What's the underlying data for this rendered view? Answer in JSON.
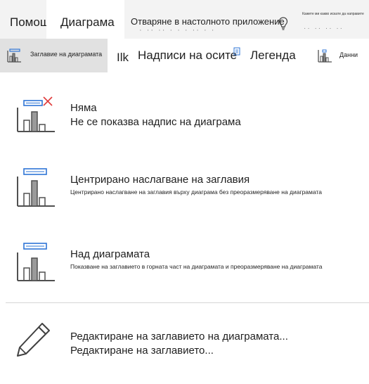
{
  "tabs": {
    "help": "Помощ",
    "chart": "Диаграма",
    "open_desktop": "Отваряне в настолното приложение",
    "open_desktop_faded": "· ·· ·· ·  · · ··  · ·",
    "tell_me": "Кажете ми какво искате да направите",
    "tell_me_faded": "·· ·· ·· ··"
  },
  "ribbon": {
    "chart_title": "Заглавие на диаграмата",
    "axis_ilk": "Ilk",
    "axis_titles": "Надписи на осите",
    "legend": "Легенда",
    "data": "Данни"
  },
  "menu": {
    "items": [
      {
        "title": "Няма",
        "subtitle": "Не се показва надпис на диаграма",
        "icon": "chart-no-title-icon"
      },
      {
        "title": "Центрирано наслагване на заглавия",
        "subtitle": "Центрирано наслагване на заглавия върху диаграма без преоразмеряване на диаграмата",
        "icon": "chart-centered-overlay-title-icon"
      },
      {
        "title": "Над диаграмата",
        "subtitle": "Показване на заглавието в горната част на диаграмата и преоразмеряване на диаграмата",
        "icon": "chart-title-above-icon"
      },
      {
        "title": "Редактиране на заглавието на диаграмата...",
        "subtitle": "Редактиране на заглавието...",
        "icon": "pencil-icon"
      }
    ]
  },
  "colors": {
    "accent_blue": "#2e74d6",
    "red_x": "#e03a3a",
    "icon_gray": "#505050",
    "selected_bg": "#e1e1e1"
  }
}
